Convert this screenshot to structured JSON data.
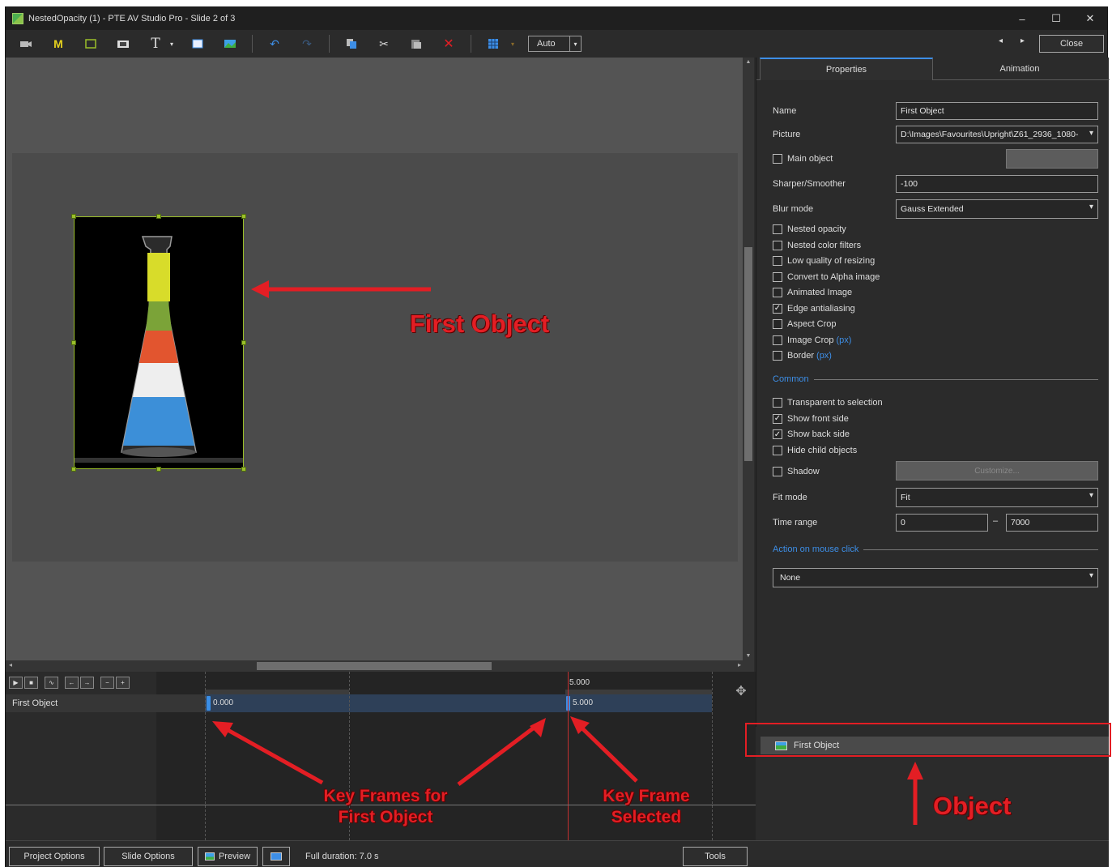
{
  "window": {
    "title": "NestedOpacity (1) - PTE AV Studio Pro - Slide 2 of 3",
    "minimize": "–",
    "maximize": "☐",
    "close": "✕"
  },
  "toolbar": {
    "auto_value": "Auto",
    "close_label": "Close",
    "prev_glyph": "◂",
    "next_glyph": "▸",
    "icons": [
      "camera-icon",
      "mask-icon",
      "frame-icon",
      "video-icon",
      "text-icon",
      "rectangle-icon",
      "image-icon",
      "undo-icon",
      "redo-icon",
      "copy-icon",
      "cut-icon",
      "paste-icon",
      "delete-icon",
      "grid-icon"
    ]
  },
  "properties": {
    "tabs": [
      "Properties",
      "Animation"
    ],
    "name_label": "Name",
    "name_value": "First Object",
    "picture_label": "Picture",
    "picture_value": "D:\\Images\\Favourites\\Upright\\Z61_2936_1080-",
    "main_object_label": "Main object",
    "sharper_label": "Sharper/Smoother",
    "sharper_value": "-100",
    "blur_label": "Blur mode",
    "blur_value": "Gauss Extended",
    "checkboxes": [
      {
        "label": "Nested opacity",
        "checked": false
      },
      {
        "label": "Nested color filters",
        "checked": false
      },
      {
        "label": "Low quality of resizing",
        "checked": false
      },
      {
        "label": "Convert to Alpha image",
        "checked": false
      },
      {
        "label": "Animated Image",
        "checked": false
      },
      {
        "label": "Edge antialiasing",
        "checked": true
      },
      {
        "label": "Aspect Crop",
        "checked": false
      },
      {
        "label": "Image Crop",
        "checked": false,
        "suffix": "(px)"
      },
      {
        "label": "Border",
        "checked": false,
        "suffix": "(px)"
      }
    ],
    "common_label": "Common",
    "common_checkboxes": [
      {
        "label": "Transparent to selection",
        "checked": false
      },
      {
        "label": "Show front side",
        "checked": true
      },
      {
        "label": "Show back side",
        "checked": true
      },
      {
        "label": "Hide child objects",
        "checked": false
      }
    ],
    "shadow_label": "Shadow",
    "customize_label": "Customize...",
    "fit_label": "Fit mode",
    "fit_value": "Fit",
    "time_label": "Time range",
    "time_from": "0",
    "time_dash": "–",
    "time_to": "7000",
    "action_label": "Action on mouse click",
    "action_value": "None"
  },
  "objects": {
    "items": [
      "First Object"
    ]
  },
  "timeline": {
    "track_name": "First Object",
    "ruler_label": "5.000",
    "keyframe1": "0.000",
    "keyframe2": "5.000"
  },
  "annotations": {
    "first_object": "First Object",
    "keyframes_line1": "Key Frames for",
    "keyframes_line2": "First Object",
    "selected_line1": "Key Frame",
    "selected_line2": "Selected",
    "object": "Object"
  },
  "statusbar": {
    "project_options": "Project Options",
    "slide_options": "Slide Options",
    "preview": "Preview",
    "full_duration": "Full duration: 7.0 s",
    "tools": "Tools"
  },
  "colors": {
    "accent": "#3d8ee6",
    "annotation_red": "#e31e24",
    "selection_green": "#9bbf2a"
  }
}
